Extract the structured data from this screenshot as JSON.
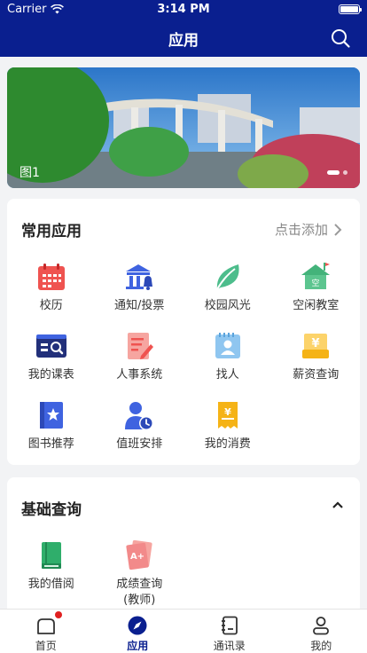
{
  "status_bar": {
    "carrier": "Carrier",
    "time": "3:14 PM"
  },
  "nav": {
    "title": "应用"
  },
  "banner": {
    "caption": "图1",
    "page_count": 2,
    "active_page": 1
  },
  "common_apps": {
    "title": "常用应用",
    "action_label": "点击添加",
    "items": [
      {
        "label": "校历",
        "icon": "calendar-icon"
      },
      {
        "label": "通知/投票",
        "icon": "building-bell-icon"
      },
      {
        "label": "校园风光",
        "icon": "leaf-icon"
      },
      {
        "label": "空闲教室",
        "icon": "classroom-house-icon"
      },
      {
        "label": "我的课表",
        "icon": "schedule-search-icon"
      },
      {
        "label": "人事系统",
        "icon": "document-edit-icon"
      },
      {
        "label": "找人",
        "icon": "contact-card-icon"
      },
      {
        "label": "薪资查询",
        "icon": "salary-icon"
      },
      {
        "label": "图书推荐",
        "icon": "book-star-icon"
      },
      {
        "label": "值班安排",
        "icon": "person-clock-icon"
      },
      {
        "label": "我的消费",
        "icon": "receipt-icon"
      }
    ]
  },
  "basic_query": {
    "title": "基础查询",
    "items": [
      {
        "label": "我的借阅",
        "icon": "borrow-book-icon"
      },
      {
        "label": "成绩查询\n(教师)",
        "icon": "grade-paper-icon"
      }
    ]
  },
  "tab_bar": {
    "items": [
      {
        "label": "首页",
        "icon": "home-icon"
      },
      {
        "label": "应用",
        "icon": "compass-icon"
      },
      {
        "label": "通讯录",
        "icon": "address-book-icon"
      },
      {
        "label": "我的",
        "icon": "person-icon"
      }
    ]
  },
  "colors": {
    "primary": "#0a1f8f",
    "badge": "#e02020",
    "red": "#ef5350",
    "blue": "#3f63e0",
    "green": "#4dbd8c",
    "yellow": "#f5b316"
  }
}
